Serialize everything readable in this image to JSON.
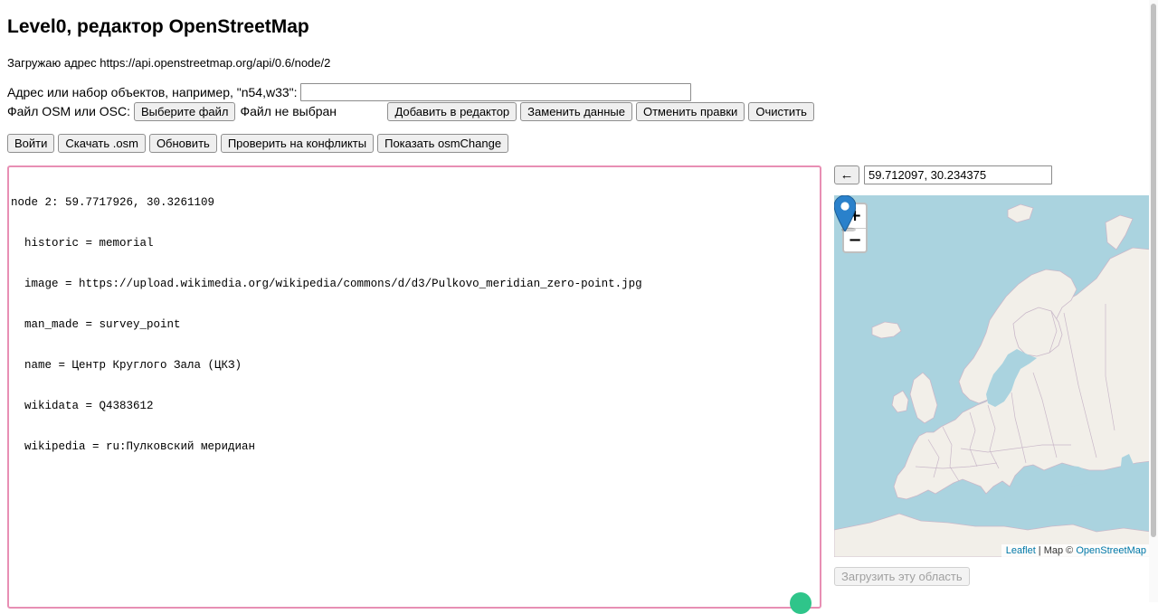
{
  "page": {
    "title": "Level0, редактор OpenStreetMap",
    "status": "Загружаю адрес https://api.openstreetmap.org/api/0.6/node/2"
  },
  "address": {
    "label": "Адрес или набор объектов, например, \"n54,w33\":",
    "value": ""
  },
  "file": {
    "label": "Файл OSM или OSC:",
    "choose_label": "Выберите файл",
    "no_file": "Файл не выбран"
  },
  "actions": {
    "add": "Добавить в редактор",
    "replace": "Заменить данные",
    "revert": "Отменить правки",
    "clear": "Очистить"
  },
  "toolbar": {
    "login": "Войти",
    "download": "Скачать .osm",
    "refresh": "Обновить",
    "check": "Проверить на конфликты",
    "show_change": "Показать osmChange"
  },
  "editor": {
    "lines": [
      "node 2: 59.7717926, 30.3261109",
      "  historic = memorial",
      "  image = https://upload.wikimedia.org/wikipedia/commons/d/d3/Pulkovo_meridian_zero-point.jpg",
      "  man_made = survey_point",
      "  name = Центр Круглого Зала (ЦКЗ)",
      "  wikidata = Q4383612",
      "  wikipedia = ru:Пулковский меридиан"
    ]
  },
  "map": {
    "back_label": "←",
    "coords": "59.712097, 30.234375",
    "zoom_in": "+",
    "zoom_out": "−",
    "attribution_leaflet": "Leaflet",
    "attribution_mid": " | Map © ",
    "attribution_osm": "OpenStreetMap",
    "load_area": "Загрузить эту область",
    "colors": {
      "water": "#aad3df",
      "land": "#f2efe9",
      "border": "#c9b8c9",
      "marker": "#2a81cb"
    }
  }
}
